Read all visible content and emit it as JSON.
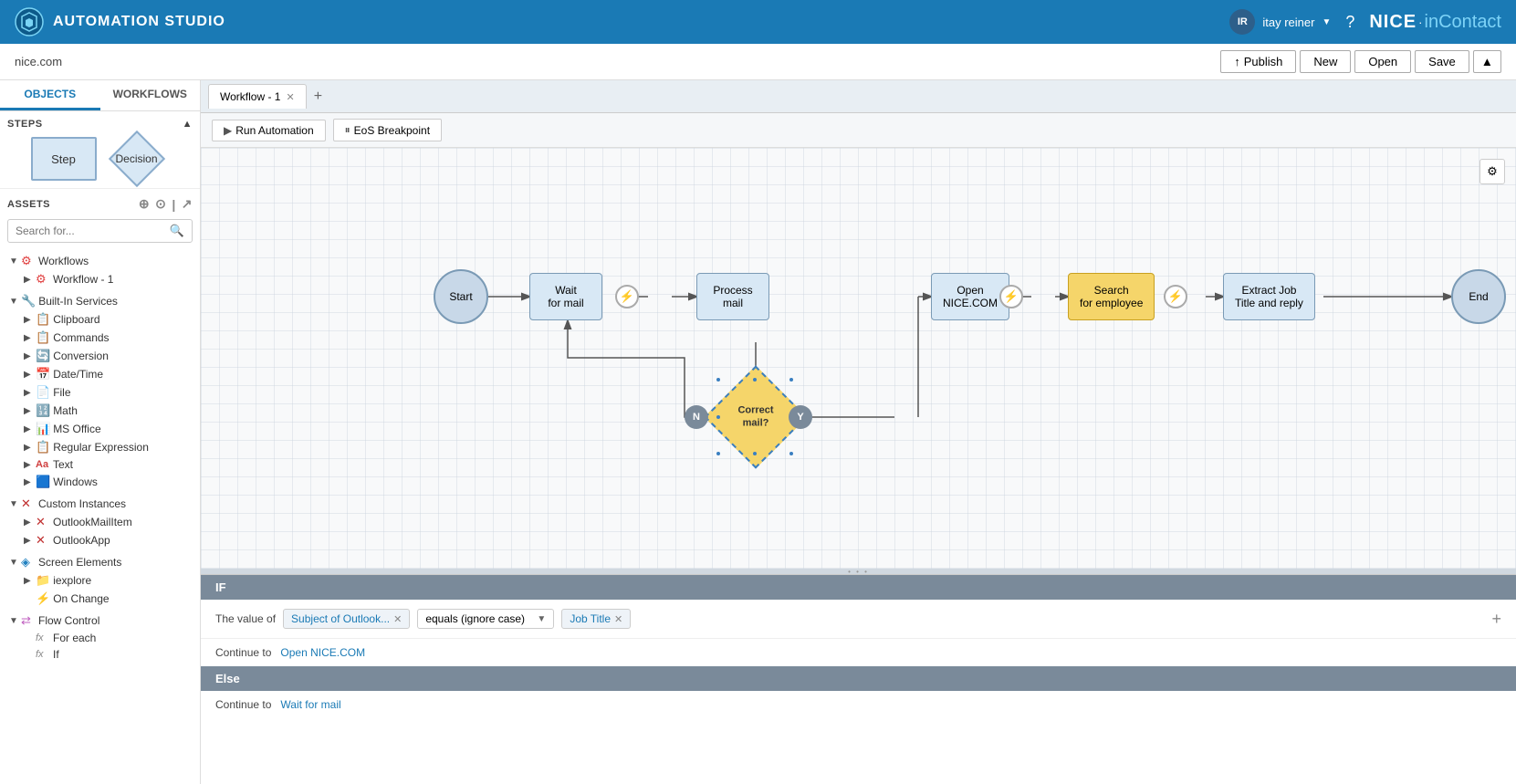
{
  "app": {
    "title": "AUTOMATION STUDIO",
    "logo_text": "NICE",
    "logo_sub": "inContact"
  },
  "header": {
    "user_initials": "IR",
    "user_name": "itay reiner",
    "site": "nice.com",
    "buttons": {
      "publish": "Publish",
      "new": "New",
      "open": "Open",
      "save": "Save"
    }
  },
  "sidebar": {
    "tabs": [
      "OBJECTS",
      "WORKFLOWS"
    ],
    "active_tab": "OBJECTS",
    "steps_label": "STEPS",
    "assets_label": "ASSETS",
    "step_label": "Step",
    "decision_label": "Decision",
    "search_placeholder": "Search for...",
    "tree": [
      {
        "label": "Workflows",
        "icon": "🔴",
        "expanded": true,
        "children": [
          {
            "label": "Workflow - 1",
            "icon": "🔴",
            "children": []
          }
        ]
      },
      {
        "label": "Built-In Services",
        "icon": "🔴",
        "expanded": true,
        "children": [
          {
            "label": "Clipboard",
            "icon": "📋",
            "children": []
          },
          {
            "label": "Commands",
            "icon": "📋",
            "children": []
          },
          {
            "label": "Conversion",
            "icon": "🔄",
            "children": []
          },
          {
            "label": "Date/Time",
            "icon": "📅",
            "children": []
          },
          {
            "label": "File",
            "icon": "📄",
            "children": []
          },
          {
            "label": "Math",
            "icon": "🔢",
            "children": []
          },
          {
            "label": "MS Office",
            "icon": "📊",
            "children": []
          },
          {
            "label": "Regular Expression",
            "icon": "📋",
            "children": []
          },
          {
            "label": "Text",
            "icon": "Aa",
            "children": []
          },
          {
            "label": "Windows",
            "icon": "🟦",
            "children": []
          }
        ]
      },
      {
        "label": "Custom Instances",
        "icon": "❌",
        "expanded": true,
        "children": [
          {
            "label": "OutlookMailItem",
            "icon": "❌",
            "children": []
          },
          {
            "label": "OutlookApp",
            "icon": "❌",
            "children": []
          }
        ]
      },
      {
        "label": "Screen Elements",
        "icon": "🔷",
        "expanded": true,
        "children": [
          {
            "label": "iexplore",
            "icon": "📁",
            "children": []
          },
          {
            "label": "On Change",
            "icon": "⚡",
            "children": []
          }
        ]
      },
      {
        "label": "Flow Control",
        "icon": "🔀",
        "expanded": true,
        "children": [
          {
            "label": "For each",
            "icon": "fx",
            "children": []
          },
          {
            "label": "If",
            "icon": "fx",
            "children": []
          }
        ]
      }
    ]
  },
  "workflow": {
    "tab_label": "Workflow - 1",
    "toolbar": {
      "run_automation": "Run Automation",
      "eos_breakpoint": "EoS Breakpoint"
    },
    "nodes": {
      "start": "Start",
      "wait_for_mail": "Wait\nfor mail",
      "process_mail": "Process\nmail",
      "correct_mail": "Correct\nmail?",
      "open_nice": "Open\nNICE.COM",
      "search_employee": "Search\nfor employee",
      "extract_job": "Extract Job\nTitle and reply",
      "end": "End"
    },
    "connectors": {
      "n_label": "N",
      "y_label": "Y"
    }
  },
  "bottom_panel": {
    "if_label": "IF",
    "else_label": "Else",
    "condition_prefix": "The value of",
    "condition_field": "Subject of Outlook...",
    "condition_operator": "equals (ignore case)",
    "condition_value": "Job Title",
    "continue_to_prefix": "Continue to",
    "continue_open": "Open NICE.COM",
    "continue_wait": "Wait for mail"
  }
}
